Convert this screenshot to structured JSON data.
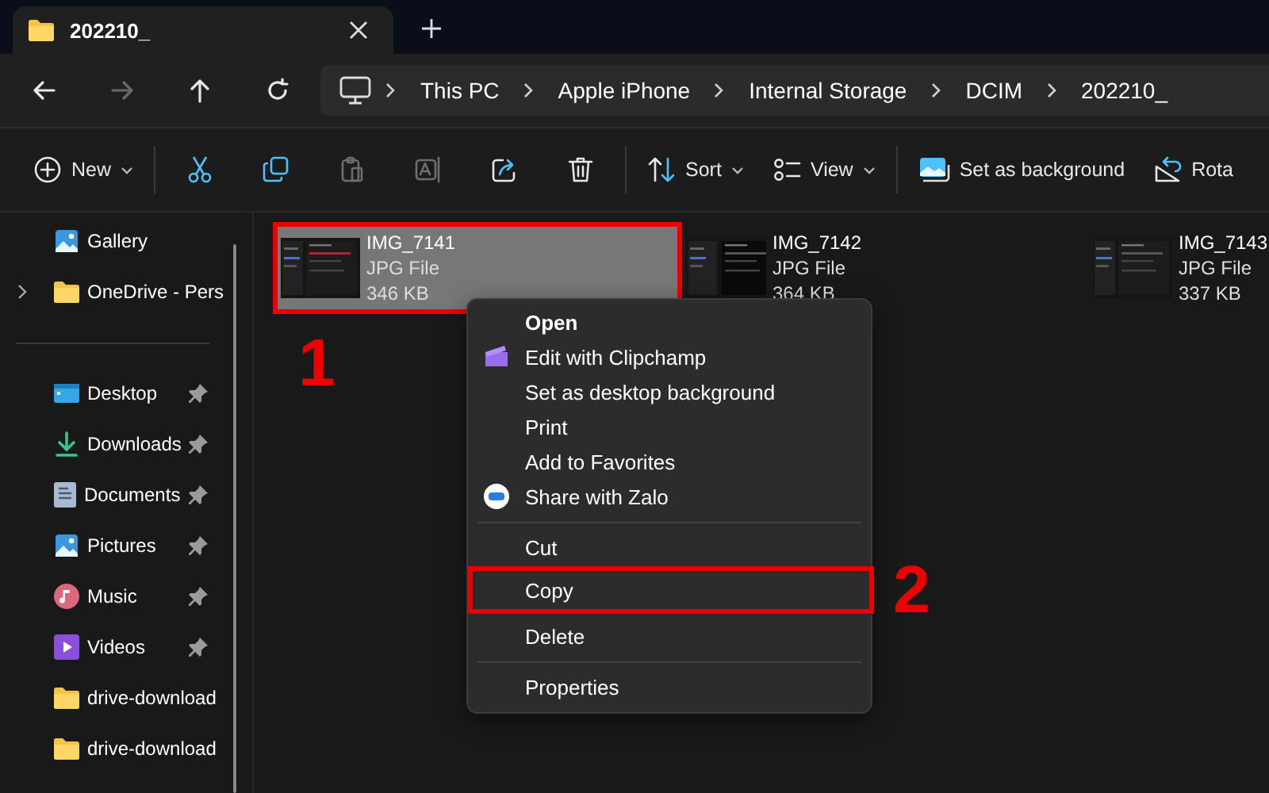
{
  "tab": {
    "title": "202210_"
  },
  "nav_buttons": [
    {
      "kind": "back",
      "disabled": false
    },
    {
      "kind": "forward",
      "disabled": true
    },
    {
      "kind": "up",
      "disabled": false
    },
    {
      "kind": "refresh",
      "disabled": false
    }
  ],
  "breadcrumb": [
    "This PC",
    "Apple iPhone",
    "Internal Storage",
    "DCIM",
    "202210_"
  ],
  "toolbar": [
    {
      "kind": "new",
      "label": "New",
      "disabled": false
    },
    {
      "kind": "separator"
    },
    {
      "kind": "cut",
      "disabled": false
    },
    {
      "kind": "copy",
      "disabled": false
    },
    {
      "kind": "paste",
      "disabled": true
    },
    {
      "kind": "rename",
      "disabled": true
    },
    {
      "kind": "share",
      "disabled": false
    },
    {
      "kind": "delete",
      "disabled": false
    },
    {
      "kind": "separator"
    },
    {
      "kind": "sort",
      "label": "Sort",
      "disabled": false
    },
    {
      "kind": "view",
      "label": "View",
      "disabled": false
    },
    {
      "kind": "separator"
    },
    {
      "kind": "background",
      "label": "Set as background",
      "disabled": false
    },
    {
      "kind": "rotate",
      "label": "Rota",
      "disabled": false
    }
  ],
  "sidebar": {
    "groups": [
      [
        {
          "kind": "gallery",
          "label": "Gallery",
          "pinned": false,
          "expandable": false
        },
        {
          "kind": "folder",
          "label": "OneDrive - Pers",
          "pinned": false,
          "expandable": true
        }
      ],
      [
        {
          "kind": "desktop",
          "label": "Desktop",
          "pinned": true,
          "expandable": false
        },
        {
          "kind": "downloads",
          "label": "Downloads",
          "pinned": true,
          "expandable": false
        },
        {
          "kind": "documents",
          "label": "Documents",
          "pinned": true,
          "expandable": false
        },
        {
          "kind": "pictures",
          "label": "Pictures",
          "pinned": true,
          "expandable": false
        },
        {
          "kind": "music",
          "label": "Music",
          "pinned": true,
          "expandable": false
        },
        {
          "kind": "videos",
          "label": "Videos",
          "pinned": true,
          "expandable": false
        },
        {
          "kind": "folder",
          "label": "drive-download",
          "pinned": false,
          "expandable": false
        },
        {
          "kind": "folder",
          "label": "drive-download",
          "pinned": false,
          "expandable": false
        }
      ]
    ]
  },
  "files": [
    {
      "name": "IMG_7141",
      "type": "JPG File",
      "size": "346 KB",
      "selected": true,
      "annotation": "1"
    },
    {
      "name": "IMG_7142",
      "type": "JPG File",
      "size": "364 KB",
      "selected": false
    },
    {
      "name": "IMG_7143",
      "type": "JPG File",
      "size": "337 KB",
      "selected": false
    }
  ],
  "context_menu": [
    {
      "kind": "item",
      "label": "Open",
      "default": true
    },
    {
      "kind": "edit-app",
      "label": "Edit with Clipchamp",
      "default": false
    },
    {
      "kind": "item",
      "label": "Set as desktop background",
      "default": false
    },
    {
      "kind": "item",
      "label": "Print",
      "default": false
    },
    {
      "kind": "item",
      "label": "Add to Favorites",
      "default": false
    },
    {
      "kind": "share-app",
      "label": "Share with Zalo",
      "default": false
    },
    {
      "kind": "separator"
    },
    {
      "kind": "item",
      "label": "Cut",
      "default": false
    },
    {
      "kind": "item",
      "label": "Copy",
      "default": false,
      "annotation": "2"
    },
    {
      "kind": "item",
      "label": "Delete",
      "default": false
    },
    {
      "kind": "separator"
    },
    {
      "kind": "item",
      "label": "Properties",
      "default": false
    }
  ]
}
